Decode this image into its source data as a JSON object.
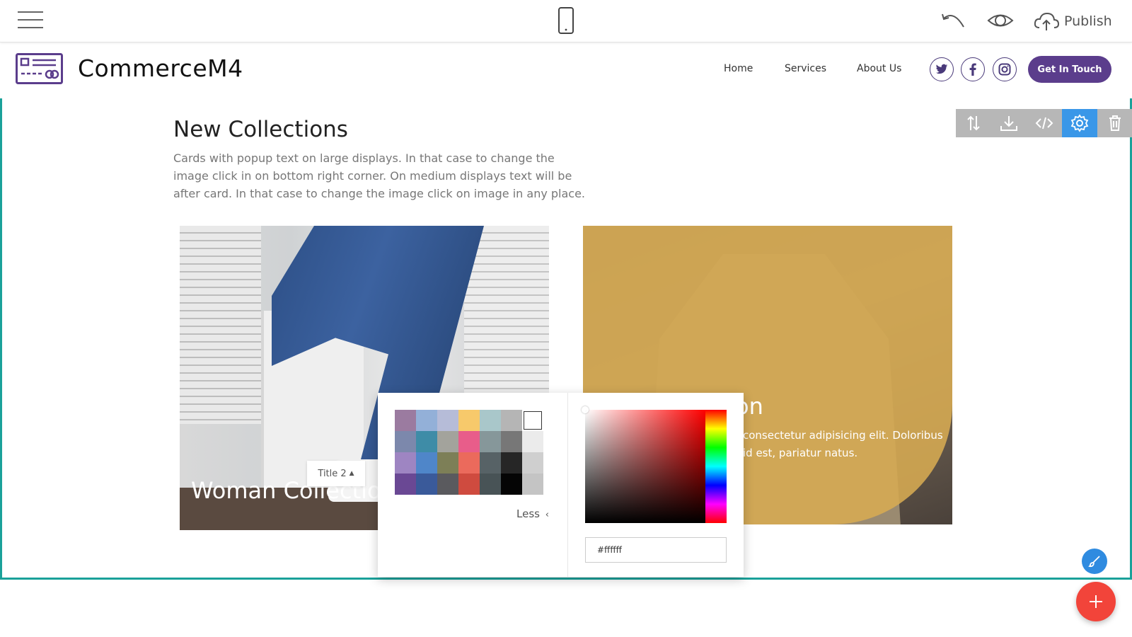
{
  "editor": {
    "publish_label": "Publish",
    "icons": [
      "menu-icon",
      "phone-icon",
      "undo-icon",
      "eye-icon",
      "cloud-upload-icon"
    ]
  },
  "site_header": {
    "brand": "CommerceM4",
    "nav": [
      "Home",
      "Services",
      "About Us"
    ],
    "social": [
      "twitter-icon",
      "facebook-icon",
      "instagram-icon"
    ],
    "cta": "Get In Touch",
    "cta_color": "#5b3d8c"
  },
  "section": {
    "border_color": "#1aa19a",
    "toolbar": [
      "reorder-icon",
      "download-icon",
      "code-icon",
      "gear-icon",
      "trash-icon"
    ],
    "title": "New Collections",
    "description": "Cards with popup text on large displays. In that case to change the image click in on bottom right corner. On medium displays text will be after card. In that case to change the image click on image in any place."
  },
  "cards": [
    {
      "title": "Woman Collectio",
      "title_style_chip": "Title 2"
    },
    {
      "title": "on",
      "text": "consectetur adipisicing elit. Doloribus id est, pariatur natus.",
      "overlay_color": "#d7ab52"
    }
  ],
  "color_picker": {
    "less_label": "Less",
    "hex_value": "#ffffff",
    "swatches": [
      "#9b7ba0",
      "#93b0d8",
      "#b6bcd8",
      "#f7c96b",
      "#a9c7ca",
      "#b5b5b5",
      "#ffffff",
      "#7c88ac",
      "#3e8ca7",
      "#a3a39c",
      "#e85d8a",
      "#86979a",
      "#777777",
      "#ebebeb",
      "#9e85c2",
      "#4f86c9",
      "#7d7f57",
      "#eb6a5c",
      "#576266",
      "#262626",
      "#cfcfcf",
      "#6a4894",
      "#3a5a9a",
      "#5a5a5e",
      "#cf4b3f",
      "#485356",
      "#050505",
      "#c4c4c4"
    ],
    "selected_swatch": 6
  },
  "floating": {
    "brush": "paint-brush-icon",
    "add": "plus-icon"
  }
}
